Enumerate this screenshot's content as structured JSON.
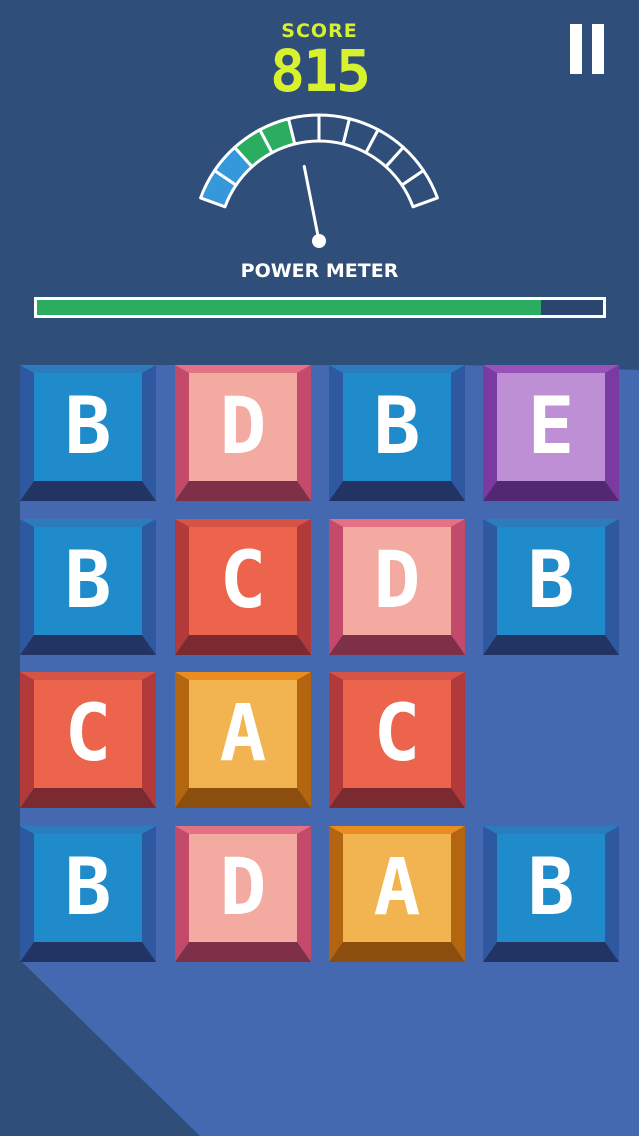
{
  "header": {
    "score_label": "SCORE",
    "score_value": "815"
  },
  "pause_button": {
    "icon": "pause-icon"
  },
  "power_meter": {
    "label": "POWER METER",
    "segments_total": 10,
    "segments_filled": 4,
    "segment_colors": [
      "#3498db",
      "#3498db",
      "#2aad60",
      "#2aad60"
    ],
    "needle_level": 0.42,
    "bar_fill_fraction": 0.89,
    "bar_color": "#2aad60"
  },
  "board": {
    "rows": [
      [
        "B",
        "D",
        "B",
        "E"
      ],
      [
        "B",
        "C",
        "D",
        "B"
      ],
      [
        "C",
        "A",
        "C",
        ""
      ],
      [
        "B",
        "D",
        "A",
        "B"
      ]
    ]
  },
  "colors": {
    "background": "#304e7a",
    "board_shadow": "#4469b0",
    "score": "#d8f12f",
    "letter_colors": {
      "A": {
        "face": "#f2b451",
        "top": "#ea8c1e",
        "side": "#b46510",
        "bottom": "#8c4e0c"
      },
      "B": {
        "face": "#1f8bcb",
        "top": "#2a7cbd",
        "side": "#2e58a0",
        "bottom": "#223463"
      },
      "C": {
        "face": "#ec644c",
        "top": "#d65446",
        "side": "#b23a3a",
        "bottom": "#7b2a30"
      },
      "D": {
        "face": "#f3aaa0",
        "top": "#e57184",
        "side": "#c44a6c",
        "bottom": "#7f3049"
      },
      "E": {
        "face": "#bf8fd6",
        "top": "#9a52bb",
        "side": "#7a3aa0",
        "bottom": "#522873"
      }
    }
  }
}
